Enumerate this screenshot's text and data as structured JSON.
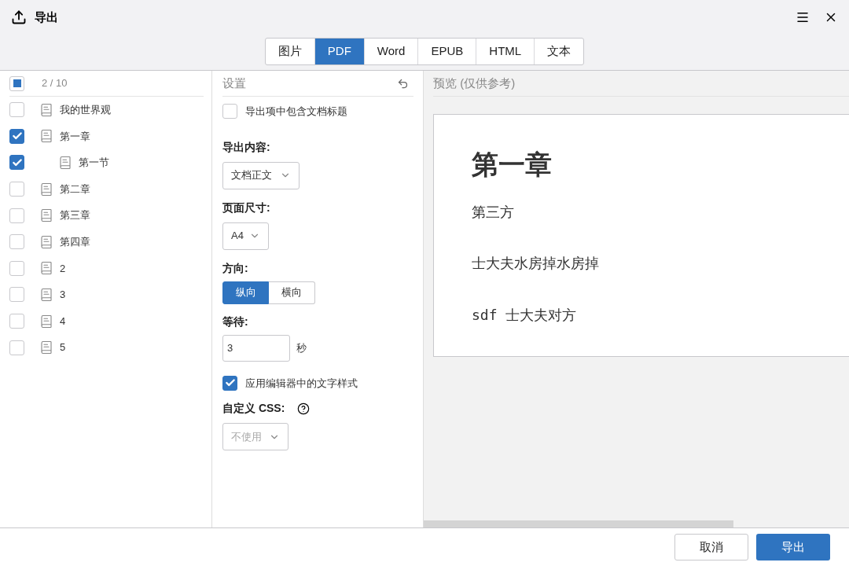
{
  "window": {
    "title": "导出"
  },
  "tabs": [
    {
      "label": "图片",
      "selected": false
    },
    {
      "label": "PDF",
      "selected": true
    },
    {
      "label": "Word",
      "selected": false
    },
    {
      "label": "EPUB",
      "selected": false
    },
    {
      "label": "HTML",
      "selected": false
    },
    {
      "label": "文本",
      "selected": false
    }
  ],
  "tree": {
    "select_all": {
      "checked": false,
      "indeterminate": true
    },
    "count": "2 / 10",
    "items": [
      {
        "label": "我的世界观",
        "checked": false
      },
      {
        "label": "第一章",
        "checked": true,
        "children": [
          {
            "label": "第一节",
            "checked": true
          }
        ]
      },
      {
        "label": "第二章",
        "checked": false
      },
      {
        "label": "第三章",
        "checked": false
      },
      {
        "label": "第四章",
        "checked": false
      },
      {
        "label": "2",
        "checked": false
      },
      {
        "label": "3",
        "checked": false
      },
      {
        "label": "4",
        "checked": false
      },
      {
        "label": "5",
        "checked": false
      }
    ]
  },
  "settings": {
    "title": "设置",
    "include_title": {
      "label": "导出项中包含文档标题",
      "checked": false
    },
    "content": {
      "label": "导出内容:",
      "value": "文档正文",
      "disabled": false
    },
    "page_size": {
      "label": "页面尺寸:",
      "value": "A4",
      "disabled": false
    },
    "orientation": {
      "label": "方向:",
      "options": [
        {
          "label": "纵向",
          "selected": true
        },
        {
          "label": "横向",
          "selected": false
        }
      ]
    },
    "wait": {
      "label": "等待:",
      "value": "3",
      "unit": "秒"
    },
    "editor_styles": {
      "label": "应用编辑器中的文字样式",
      "checked": true
    },
    "custom_css": {
      "label": "自定义 CSS:",
      "value": "不使用",
      "disabled": true
    }
  },
  "preview": {
    "title": "预览 (仅供参考)",
    "blocks": [
      {
        "kind": "heading",
        "text": "第一章"
      },
      {
        "kind": "paragraph",
        "text": "第三方"
      },
      {
        "kind": "paragraph",
        "text": "士大夫水房掉水房掉"
      },
      {
        "kind": "code",
        "text": "sdf 士大夫对方"
      }
    ]
  },
  "buttons": [
    {
      "label": "取消",
      "kind": "secondary"
    },
    {
      "label": "导出",
      "kind": "primary"
    }
  ]
}
